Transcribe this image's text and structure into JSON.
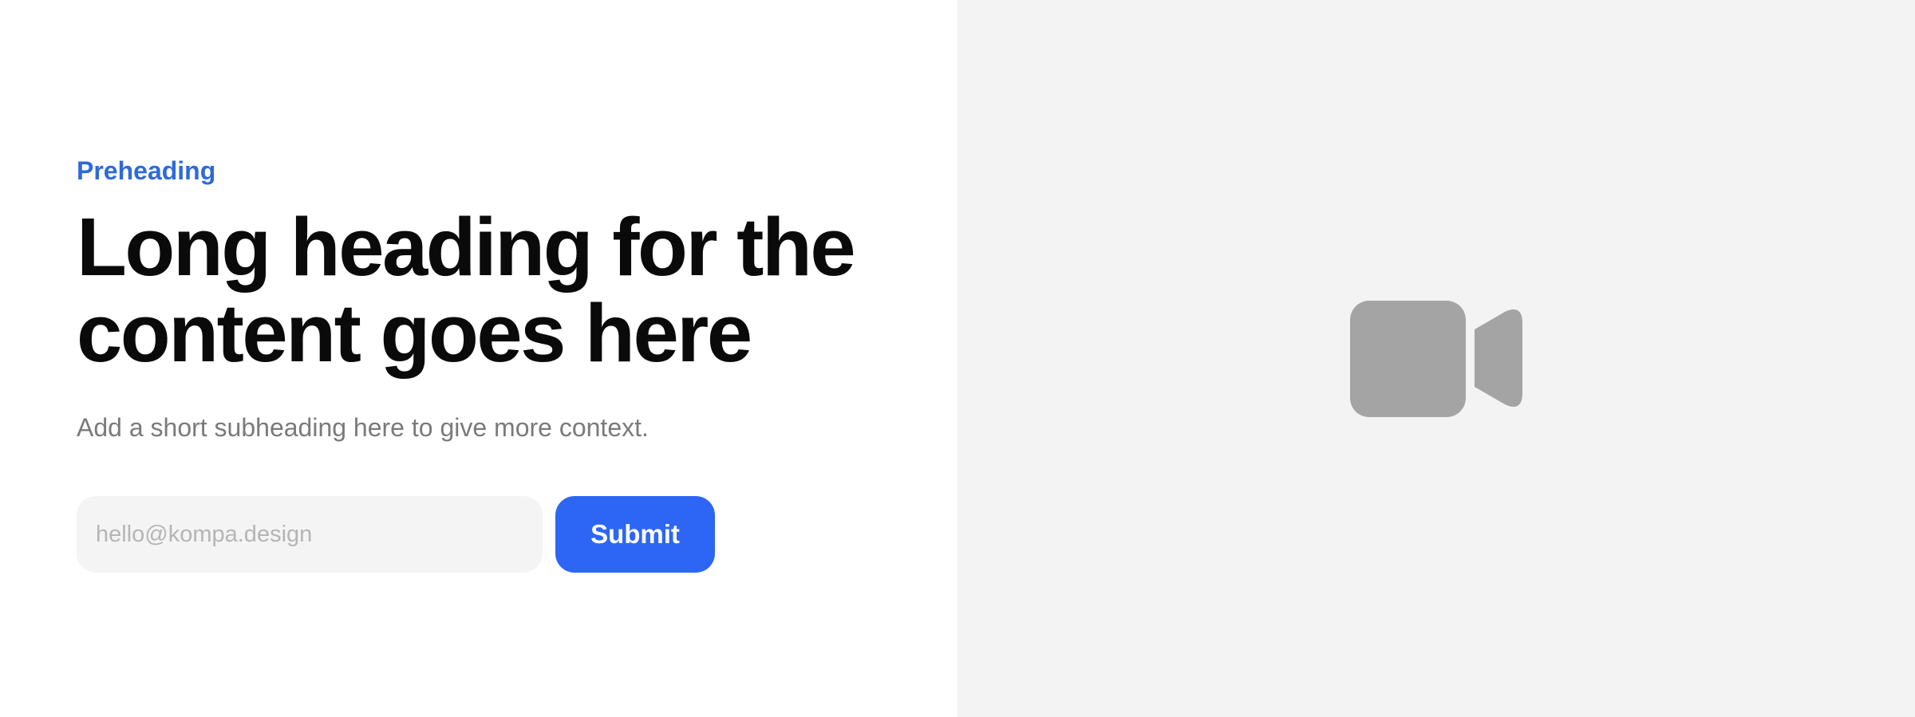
{
  "hero": {
    "preheading": "Preheading",
    "heading": "Long heading for the content goes here",
    "subheading": "Add a short subheading here to give more context.",
    "form": {
      "email_placeholder": "hello@kompa.design",
      "email_value": "",
      "submit_label": "Submit"
    }
  },
  "media": {
    "icon": "video-camera-icon"
  },
  "colors": {
    "accent": "#2d66f5",
    "preheading": "#2f6ad9",
    "media_background": "#f3f3f3",
    "icon": "#a4a4a4"
  }
}
